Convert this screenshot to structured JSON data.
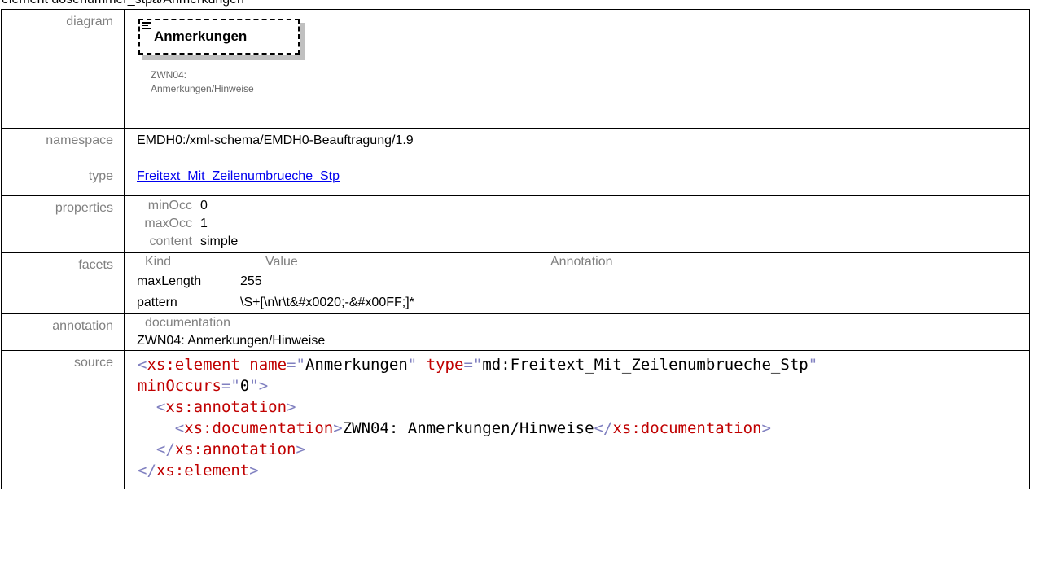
{
  "heading": "element dosenummer_stpa/Anmerkungen",
  "rows": {
    "diagram": {
      "label": "diagram",
      "node_name": "Anmerkungen",
      "caption_line1": "ZWN04:",
      "caption_line2": "Anmerkungen/Hinweise"
    },
    "namespace": {
      "label": "namespace",
      "value": "EMDH0:/xml-schema/EMDH0-Beauftragung/1.9"
    },
    "type": {
      "label": "type",
      "value": "Freitext_Mit_Zeilenumbrueche_Stp"
    },
    "properties": {
      "label": "properties",
      "items": [
        {
          "key": "minOcc",
          "value": "0"
        },
        {
          "key": "maxOcc",
          "value": "1"
        },
        {
          "key": "content",
          "value": "simple"
        }
      ]
    },
    "facets": {
      "label": "facets",
      "headers": {
        "kind": "Kind",
        "value": "Value",
        "annotation": "Annotation"
      },
      "items": [
        {
          "kind": "maxLength",
          "value": "255"
        },
        {
          "kind": "pattern",
          "value": "\\S+[\\n\\r\\t&#x0020;-&#x00FF;]*"
        }
      ]
    },
    "annotation": {
      "label": "annotation",
      "title": "documentation",
      "text": "ZWN04: Anmerkungen/Hinweise"
    },
    "source": {
      "label": "source",
      "code": {
        "l1_open": "<",
        "l1_tag": "xs:element",
        "l1_attr1": " name",
        "l1_eq1": "=\"",
        "l1_val1": "Anmerkungen",
        "l1_q1": "\"",
        "l1_attr2": " type",
        "l1_eq2": "=\"",
        "l1_val2": "md:Freitext_Mit_Zeilenumbrueche_Stp",
        "l1_q2": "\"",
        "l2_attr": "minOccurs",
        "l2_eq": "=\"",
        "l2_val": "0",
        "l2_close": "\">",
        "l3_open": "  <",
        "l3_tag": "xs:annotation",
        "l3_close": ">",
        "l4_open": "    <",
        "l4_tag": "xs:documentation",
        "l4_mid": ">",
        "l4_text": "ZWN04: Anmerkungen/Hinweise",
        "l4_end_open": "</",
        "l4_end_tag": "xs:documentation",
        "l4_end_close": ">",
        "l5_open": "  </",
        "l5_tag": "xs:annotation",
        "l5_close": ">",
        "l6_open": "</",
        "l6_tag": "xs:element",
        "l6_close": ">"
      }
    }
  }
}
